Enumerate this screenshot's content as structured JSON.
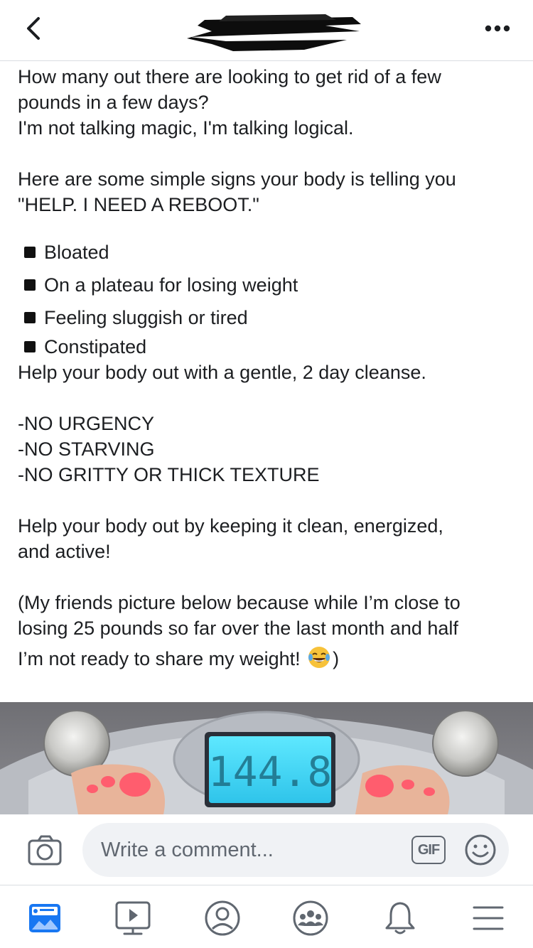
{
  "header": {
    "back_icon": "chevron-left-icon",
    "title_redacted": true,
    "more_icon": "more-dots-icon"
  },
  "post": {
    "intro_1": "How many out there are looking to get rid of a few",
    "intro_2": "pounds in a few days?",
    "intro_3": "I'm not talking magic, I'm talking logical.",
    "signs_1": "Here are some simple signs your body is telling you",
    "signs_2": "\"HELP. I NEED A REBOOT.\"",
    "bullets": [
      "Bloated",
      "On a plateau for losing weight",
      "Feeling sluggish or tired",
      "Constipated"
    ],
    "cleanse": "Help your body out with a gentle, 2 day cleanse.",
    "no_1": "-NO URGENCY",
    "no_2": "-NO STARVING",
    "no_3": "-NO GRITTY OR THICK TEXTURE",
    "clean_1": "Help your body out by keeping it clean, energized,",
    "clean_2": "and active!",
    "friends_1": "(My friends picture below because while I’m close to",
    "friends_2": "losing 25 pounds so far over the last month and half",
    "friends_3_before": "I’m not ready to share my weight! ",
    "friends_3_after": ")",
    "emoji": "laughing-crying-emoji"
  },
  "photo": {
    "scale_reading": "144.8",
    "description_icon": "bathroom-scale-photo"
  },
  "comment_bar": {
    "camera_icon": "camera-icon",
    "placeholder": "Write a comment...",
    "gif_label": "GIF",
    "emoji_icon": "smiley-icon"
  },
  "tabbar": {
    "tabs": [
      "news-feed-icon",
      "watch-icon",
      "profile-icon",
      "groups-icon",
      "notifications-icon",
      "menu-icon"
    ],
    "active": "news-feed-icon",
    "active_color": "#1877f2"
  }
}
